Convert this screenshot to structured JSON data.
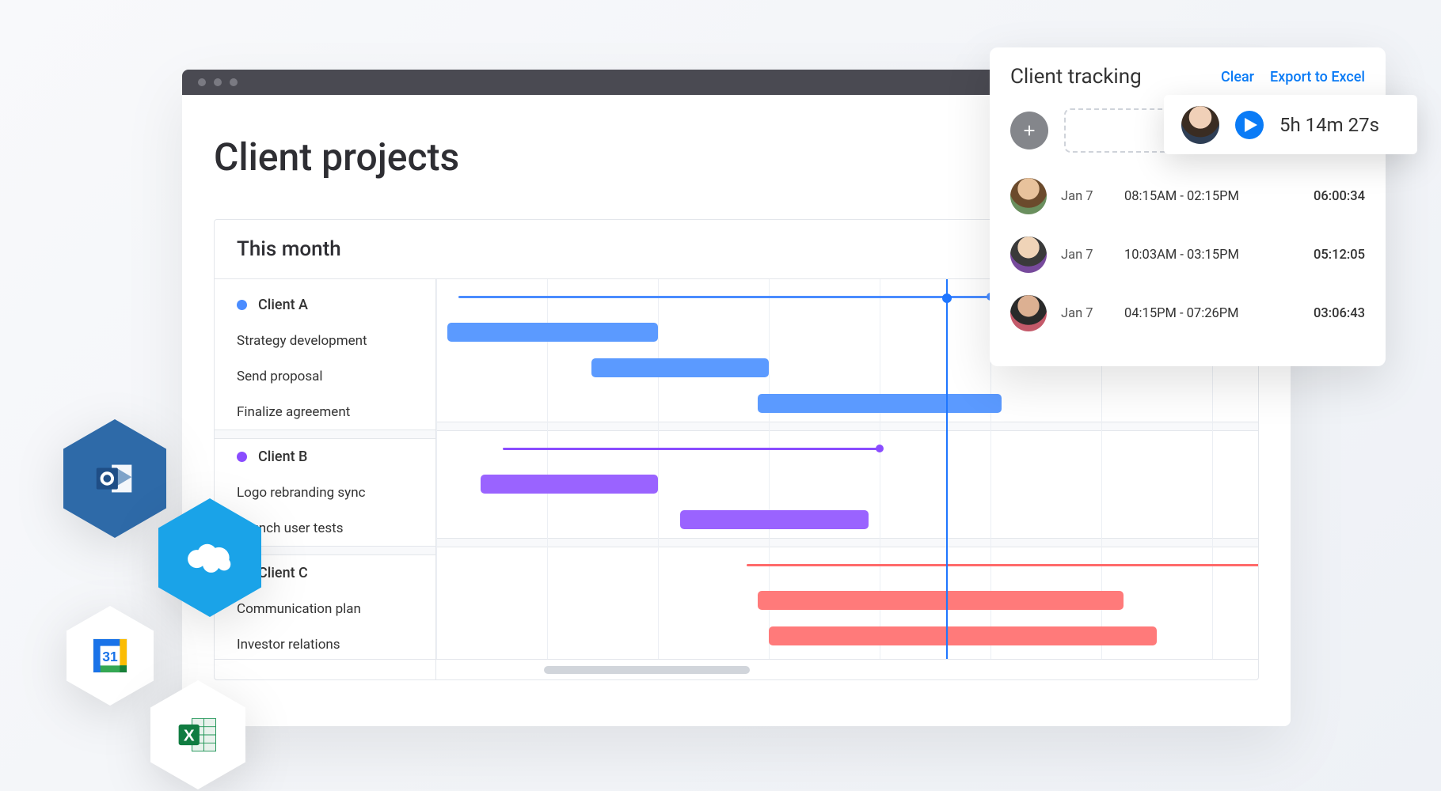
{
  "page": {
    "title": "Client projects",
    "gantt_header": "This month"
  },
  "colors": {
    "clientA": "#4a8cff",
    "clientA_bar": "#5b9aff",
    "clientB": "#8a4cff",
    "clientB_bar": "#9a63ff",
    "clientC": "#ff6a6a",
    "clientC_bar": "#ff7a7a"
  },
  "gantt": {
    "columns": 8,
    "today_col": 4.6,
    "groups": [
      {
        "name": "Client A",
        "colorKey": "clientA",
        "summary": {
          "start": 0.2,
          "end": 5.0
        },
        "tasks": [
          {
            "name": "Strategy development",
            "start": 0.1,
            "end": 2.0
          },
          {
            "name": "Send proposal",
            "start": 1.4,
            "end": 3.0
          },
          {
            "name": "Finalize agreement",
            "start": 2.9,
            "end": 5.1
          }
        ]
      },
      {
        "name": "Client B",
        "colorKey": "clientB",
        "summary": {
          "start": 0.6,
          "end": 4.0
        },
        "tasks": [
          {
            "name": "Logo rebranding sync",
            "start": 0.4,
            "end": 2.0
          },
          {
            "name": "Launch user tests",
            "start": 2.2,
            "end": 3.9
          }
        ]
      },
      {
        "name": "Client C",
        "colorKey": "clientC",
        "summary": {
          "start": 2.8,
          "end": 7.9
        },
        "tasks": [
          {
            "name": "Communication plan",
            "start": 2.9,
            "end": 6.2
          },
          {
            "name": "Investor relations",
            "start": 3.0,
            "end": 6.5
          }
        ]
      }
    ]
  },
  "tracking": {
    "title": "Client tracking",
    "clear_label": "Clear",
    "export_label": "Export to Excel",
    "live": {
      "duration": "5h 14m 27s"
    },
    "entries": [
      {
        "date": "Jan 7",
        "range": "08:15AM - 02:15PM",
        "duration": "06:00:34"
      },
      {
        "date": "Jan 7",
        "range": "10:03AM - 03:15PM",
        "duration": "05:12:05"
      },
      {
        "date": "Jan 7",
        "range": "04:15PM - 07:26PM",
        "duration": "03:06:43"
      }
    ]
  },
  "integrations": {
    "outlook": "Outlook",
    "salesforce": "Salesforce",
    "gcal": "Google Calendar",
    "gcal_day": "31",
    "excel": "Excel"
  }
}
